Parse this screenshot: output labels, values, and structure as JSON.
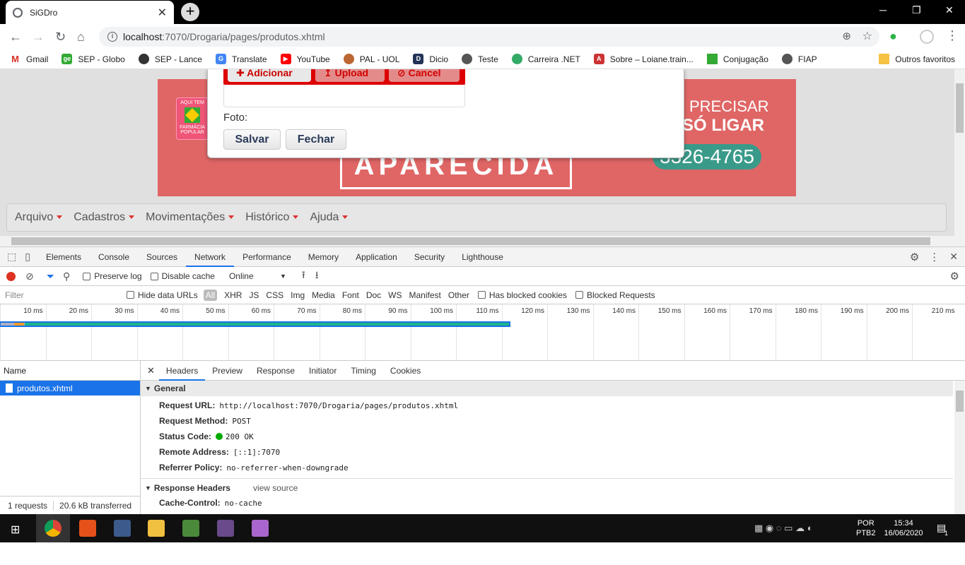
{
  "browser": {
    "tab_title": "SiGDro",
    "url_host": "localhost",
    "url_rest": ":7070/Drogaria/pages/produtos.xhtml",
    "bookmarks": [
      "Gmail",
      "SEP - Globo",
      "SEP - Lance",
      "Translate",
      "YouTube",
      "PAL - UOL",
      "Dicio",
      "Teste",
      "Carreira .NET",
      "Sobre – Loiane.train...",
      "Conjugação",
      "FIAP"
    ],
    "other_bookmarks": "Outros favoritos"
  },
  "page": {
    "upload_buttons": [
      "Adicionar",
      "Upload",
      "Cancel"
    ],
    "foto_label": "Foto:",
    "save_button": "Salvar",
    "close_button": "Fechar",
    "banner_text_1": "PRECISAR",
    "banner_text_2": "SÓ LIGAR",
    "banner_phone": "3326-4765",
    "banner_farmacia": "AQUI TEM",
    "banner_farmacia2": "FARMÁCIA POPULAR",
    "banner_big": "APARECIDA",
    "menu": [
      "Arquivo",
      "Cadastros",
      "Movimentações",
      "Histórico",
      "Ajuda"
    ]
  },
  "devtools": {
    "tabs": [
      "Elements",
      "Console",
      "Sources",
      "Network",
      "Performance",
      "Memory",
      "Application",
      "Security",
      "Lighthouse"
    ],
    "active_tab": "Network",
    "preserve_log": "Preserve log",
    "disable_cache": "Disable cache",
    "throttle": "Online",
    "filter_placeholder": "Filter",
    "hide_data_urls": "Hide data URLs",
    "types": [
      "All",
      "XHR",
      "JS",
      "CSS",
      "Img",
      "Media",
      "Font",
      "Doc",
      "WS",
      "Manifest",
      "Other"
    ],
    "has_blocked": "Has blocked cookies",
    "blocked_requests": "Blocked Requests",
    "ticks": [
      "10 ms",
      "20 ms",
      "30 ms",
      "40 ms",
      "50 ms",
      "60 ms",
      "70 ms",
      "80 ms",
      "90 ms",
      "100 ms",
      "110 ms",
      "120 ms",
      "130 ms",
      "140 ms",
      "150 ms",
      "160 ms",
      "170 ms",
      "180 ms",
      "190 ms",
      "200 ms",
      "210 ms"
    ],
    "name_header": "Name",
    "request_name": "produtos.xhtml",
    "requests_count": "1 requests",
    "transferred": "20.6 kB transferred",
    "detail_tabs": [
      "Headers",
      "Preview",
      "Response",
      "Initiator",
      "Timing",
      "Cookies"
    ],
    "general_title": "General",
    "general": [
      {
        "k": "Request URL:",
        "v": "http://localhost:7070/Drogaria/pages/produtos.xhtml"
      },
      {
        "k": "Request Method:",
        "v": "POST"
      },
      {
        "k": "Status Code:",
        "v": "200 OK"
      },
      {
        "k": "Remote Address:",
        "v": "[::1]:7070"
      },
      {
        "k": "Referrer Policy:",
        "v": "no-referrer-when-downgrade"
      }
    ],
    "response_headers_title": "Response Headers",
    "view_source": "view source",
    "cache_control_key": "Cache-Control:",
    "cache_control_val": "no-cache"
  },
  "taskbar": {
    "lang1": "POR",
    "lang2": "PTB2",
    "time": "15:34",
    "date": "16/06/2020",
    "notif": "1"
  },
  "colors": {
    "accent": "#1a73e8",
    "selected_row": "#1a73e8",
    "banner": "#e06666"
  }
}
